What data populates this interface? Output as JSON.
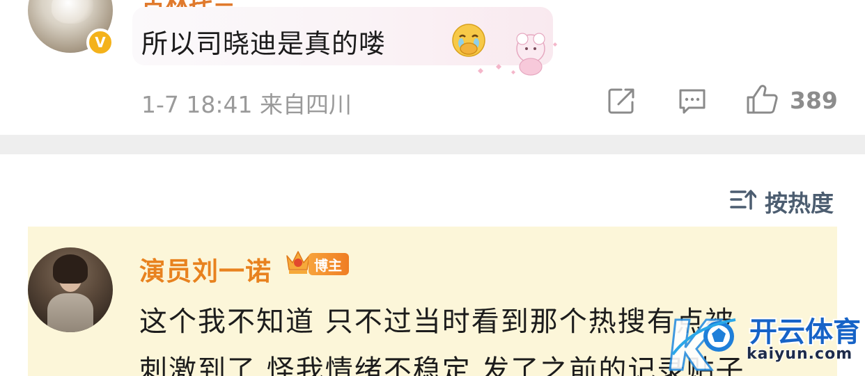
{
  "top_comment": {
    "username": "古林托兰",
    "verified_badge": "V",
    "text": "所以司晓迪是真的喽",
    "emoji": "covering-mouth-tears-emoji",
    "meta": "1-7 18:41 来自四川",
    "likes": "389"
  },
  "sort": {
    "label": "按热度"
  },
  "reply": {
    "author": "演员刘一诺",
    "badge": "博主",
    "line1": "这个我不知道 只不过当时看到那个热搜有点被",
    "line2": "刺激到了 怪我情绪不稳定 发了之前的记录贴子"
  },
  "watermark": {
    "title": "开云体育",
    "url": "kaiyun.com"
  },
  "colors": {
    "author_orange": "#e8821f",
    "highlight_bg": "#fcf6d9",
    "meta_gray": "#9a9a9a",
    "sort_blue_gray": "#4c5d70",
    "watermark_blue": "#1663c7"
  }
}
